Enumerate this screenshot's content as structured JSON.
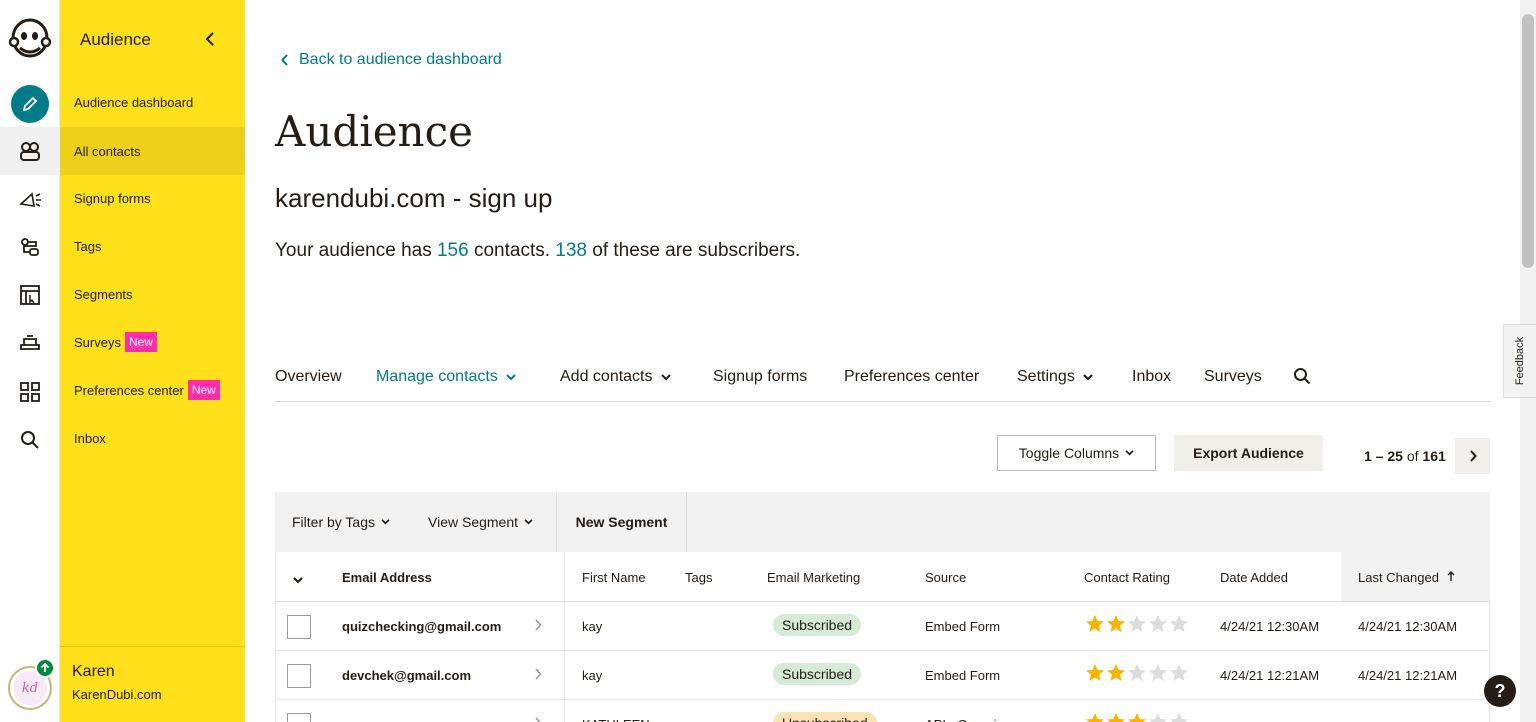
{
  "colors": {
    "accent": "#007c89",
    "sidebar": "#ffe01b",
    "new_badge": "#ff2dac"
  },
  "rail": {
    "icons": [
      "mailchimp-logo-icon",
      "create-pencil-icon",
      "audience-icon",
      "campaigns-megaphone-icon",
      "automations-icon",
      "website-icon",
      "content-icon",
      "integrations-grid-icon",
      "search-icon"
    ]
  },
  "sidebar": {
    "title": "Audience",
    "items": [
      {
        "label": "Audience dashboard"
      },
      {
        "label": "All contacts",
        "active": true
      },
      {
        "label": "Signup forms"
      },
      {
        "label": "Tags"
      },
      {
        "label": "Segments"
      },
      {
        "label": "Surveys",
        "badge": "New"
      },
      {
        "label": "Preferences center",
        "badge": "New"
      },
      {
        "label": "Inbox"
      }
    ],
    "account_name": "Karen",
    "account_org": "KarenDubi.com",
    "avatar_initials": "kd"
  },
  "main": {
    "back_link": "Back to audience dashboard",
    "title": "Audience",
    "audience_name": "karendubi.com - sign up",
    "summary": {
      "prefix": "Your audience has ",
      "contacts": "156",
      "middle": " contacts. ",
      "subscribers": "138",
      "suffix": " of these are subscribers."
    },
    "tabs": [
      "Overview",
      "Manage contacts",
      "Add contacts",
      "Signup forms",
      "Preferences center",
      "Settings",
      "Inbox",
      "Surveys"
    ],
    "toggle_columns": "Toggle Columns",
    "export": "Export Audience",
    "pager": {
      "range": "1 – 25",
      "of": "of",
      "total": "161"
    },
    "filters": {
      "tags": "Filter by Tags",
      "segment": "View Segment",
      "new_segment": "New Segment"
    },
    "columns": [
      "Email Address",
      "First Name",
      "Tags",
      "Email Marketing",
      "Source",
      "Contact Rating",
      "Date Added",
      "Last Changed"
    ],
    "rows": [
      {
        "email": "quizchecking@gmail.com",
        "first": "kay",
        "status": "Subscribed",
        "source": "Embed Form",
        "rating": 2,
        "added": "4/24/21 12:30AM",
        "changed": "4/24/21 12:30AM"
      },
      {
        "email": "devchek@gmail.com",
        "first": "kay",
        "status": "Subscribed",
        "source": "Embed Form",
        "rating": 2,
        "added": "4/24/21 12:21AM",
        "changed": "4/24/21 12:21AM"
      },
      {
        "email": "",
        "first": "KATHLEEN",
        "status": "Unsubscribed",
        "source": "API - Generic",
        "rating": 3,
        "added": "",
        "changed": ""
      }
    ]
  },
  "feedback": "Feedback",
  "help": "?"
}
